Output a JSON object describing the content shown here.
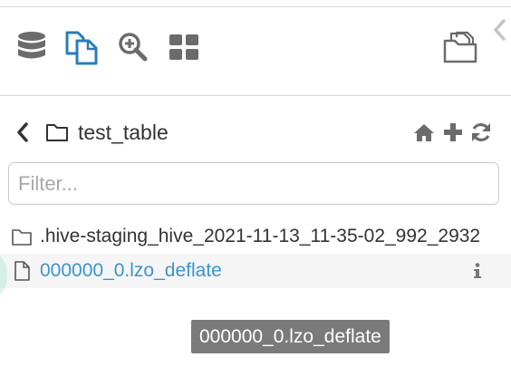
{
  "toolbar": {
    "icons": [
      "database-icon",
      "documents-icon",
      "search-zoom-icon",
      "grid-apps-icon"
    ],
    "open_folder_icon": "open-folder-icon",
    "collapse_icon": "chevron-left-icon",
    "active_color": "#2a7cb8",
    "icon_color": "#6b6b6b"
  },
  "nav": {
    "back_icon": "chevron-left-icon",
    "folder_icon": "folder-icon",
    "current_folder": "test_table",
    "actions": [
      "home-icon",
      "plus-icon",
      "refresh-icon"
    ]
  },
  "filter": {
    "placeholder": "Filter...",
    "value": ""
  },
  "files": [
    {
      "type": "folder",
      "name": ".hive-staging_hive_2021-11-13_11-35-02_992_2932"
    },
    {
      "type": "file",
      "name": "000000_0.lzo_deflate",
      "hover": true,
      "info_icon": "info-icon"
    }
  ],
  "tooltip": {
    "text": "000000_0.lzo_deflate"
  },
  "colors": {
    "link": "#3d94cc",
    "tooltip_bg": "#7a7a7a",
    "divider": "#d8d8d8"
  }
}
